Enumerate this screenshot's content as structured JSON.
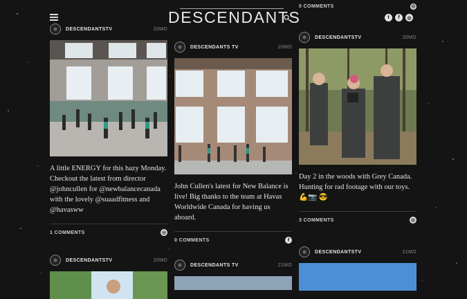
{
  "header": {
    "logo": "DESCENDANTS",
    "menu_icon": "hamburger-icon",
    "search_icon": "search-icon",
    "social": [
      {
        "icon": "twitter-icon",
        "glyph": "t"
      },
      {
        "icon": "facebook-icon",
        "glyph": "f"
      },
      {
        "icon": "instagram-icon",
        "glyph": "◎"
      }
    ]
  },
  "col3_top": {
    "comments": "0 COMMENTS",
    "source_icon": "instagram-icon"
  },
  "posts": [
    {
      "author": "DESCENDANTSTV",
      "time": "20MO",
      "caption": "A little ENERGY for this hazy Monday. Checkout the latest from director @johncullen for @newbalancecanada with the lovely @suaadfitness and @havasww",
      "comments": "1 COMMENTS",
      "source_icon": "instagram-icon",
      "source_glyph": "◎"
    },
    {
      "author": "DESCENDANTS TV",
      "time": "20MO",
      "caption": "John Cullen's latest for New Balance is live! Big thanks to the team at Havas Worldwide Canada for having us aboard.",
      "comments": "0 COMMENTS",
      "source_icon": "facebook-icon",
      "source_glyph": "f"
    },
    {
      "author": "DESCENDANTSTV",
      "time": "20MO",
      "caption": "Day 2 in the woods with Grey Canada. Hunting for rad footage with our toys.",
      "emoji": "💪📷 😎",
      "comments": "3 COMMENTS",
      "source_icon": "instagram-icon",
      "source_glyph": "◎"
    },
    {
      "author": "DESCENDANTSTV",
      "time": "20MO"
    },
    {
      "author": "DESCENDANTS TV",
      "time": "21MO"
    },
    {
      "author": "DESCENDANTSTV",
      "time": "21MO"
    }
  ]
}
